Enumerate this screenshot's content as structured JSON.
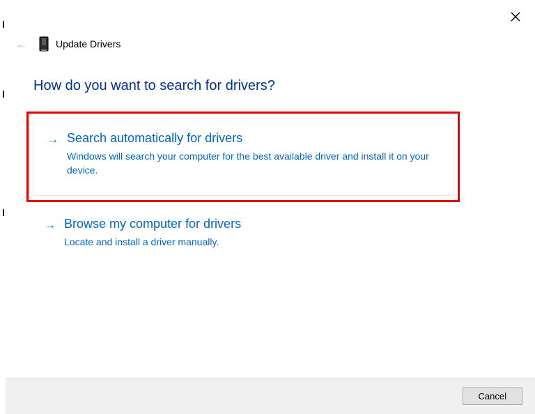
{
  "window": {
    "title": "Update Drivers"
  },
  "heading": "How do you want to search for drivers?",
  "options": [
    {
      "title": "Search automatically for drivers",
      "description": "Windows will search your computer for the best available driver and install it on your device."
    },
    {
      "title": "Browse my computer for drivers",
      "description": "Locate and install a driver manually."
    }
  ],
  "buttons": {
    "cancel": "Cancel"
  }
}
